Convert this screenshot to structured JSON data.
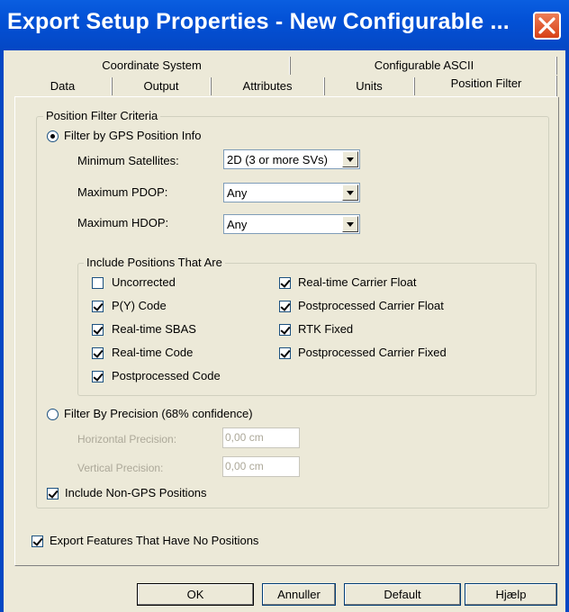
{
  "window": {
    "title": "Export Setup Properties - New Configurable ..."
  },
  "tabs": {
    "row1": [
      {
        "label": "Coordinate System"
      },
      {
        "label": "Configurable ASCII"
      }
    ],
    "row2": [
      {
        "label": "Data"
      },
      {
        "label": "Output"
      },
      {
        "label": "Attributes"
      },
      {
        "label": "Units"
      },
      {
        "label": "Position Filter",
        "selected": true
      }
    ]
  },
  "criteria": {
    "legend": "Position Filter Criteria",
    "gps_option": {
      "label": "Filter by GPS Position Info",
      "selected": true
    },
    "min_sats": {
      "label": "Minimum Satellites:",
      "value": "2D (3 or more SVs)"
    },
    "max_pdop": {
      "label": "Maximum PDOP:",
      "value": "Any"
    },
    "max_hdop": {
      "label": "Maximum HDOP:",
      "value": "Any"
    },
    "include": {
      "legend": "Include Positions That Are",
      "left": [
        {
          "label": "Uncorrected",
          "checked": false
        },
        {
          "label": "P(Y) Code",
          "checked": true
        },
        {
          "label": "Real-time SBAS",
          "checked": true
        },
        {
          "label": "Real-time Code",
          "checked": true
        },
        {
          "label": "Postprocessed Code",
          "checked": true
        }
      ],
      "right": [
        {
          "label": "Real-time Carrier Float",
          "checked": true
        },
        {
          "label": "Postprocessed Carrier Float",
          "checked": true
        },
        {
          "label": "RTK Fixed",
          "checked": true
        },
        {
          "label": "Postprocessed Carrier Fixed",
          "checked": true
        }
      ]
    },
    "precision_option": {
      "label": "Filter By Precision (68% confidence)",
      "selected": false
    },
    "horizontal_precision": {
      "label": "Horizontal Precision:",
      "value": "0,00 cm"
    },
    "vertical_precision": {
      "label": "Vertical Precision:",
      "value": "0,00 cm"
    },
    "non_gps": {
      "label": "Include Non-GPS Positions",
      "checked": true
    }
  },
  "export_no_positions": {
    "label": "Export Features That Have No Positions",
    "checked": true
  },
  "buttons": {
    "ok": "OK",
    "cancel": "Annuller",
    "default": "Default",
    "help": "Hjælp"
  }
}
